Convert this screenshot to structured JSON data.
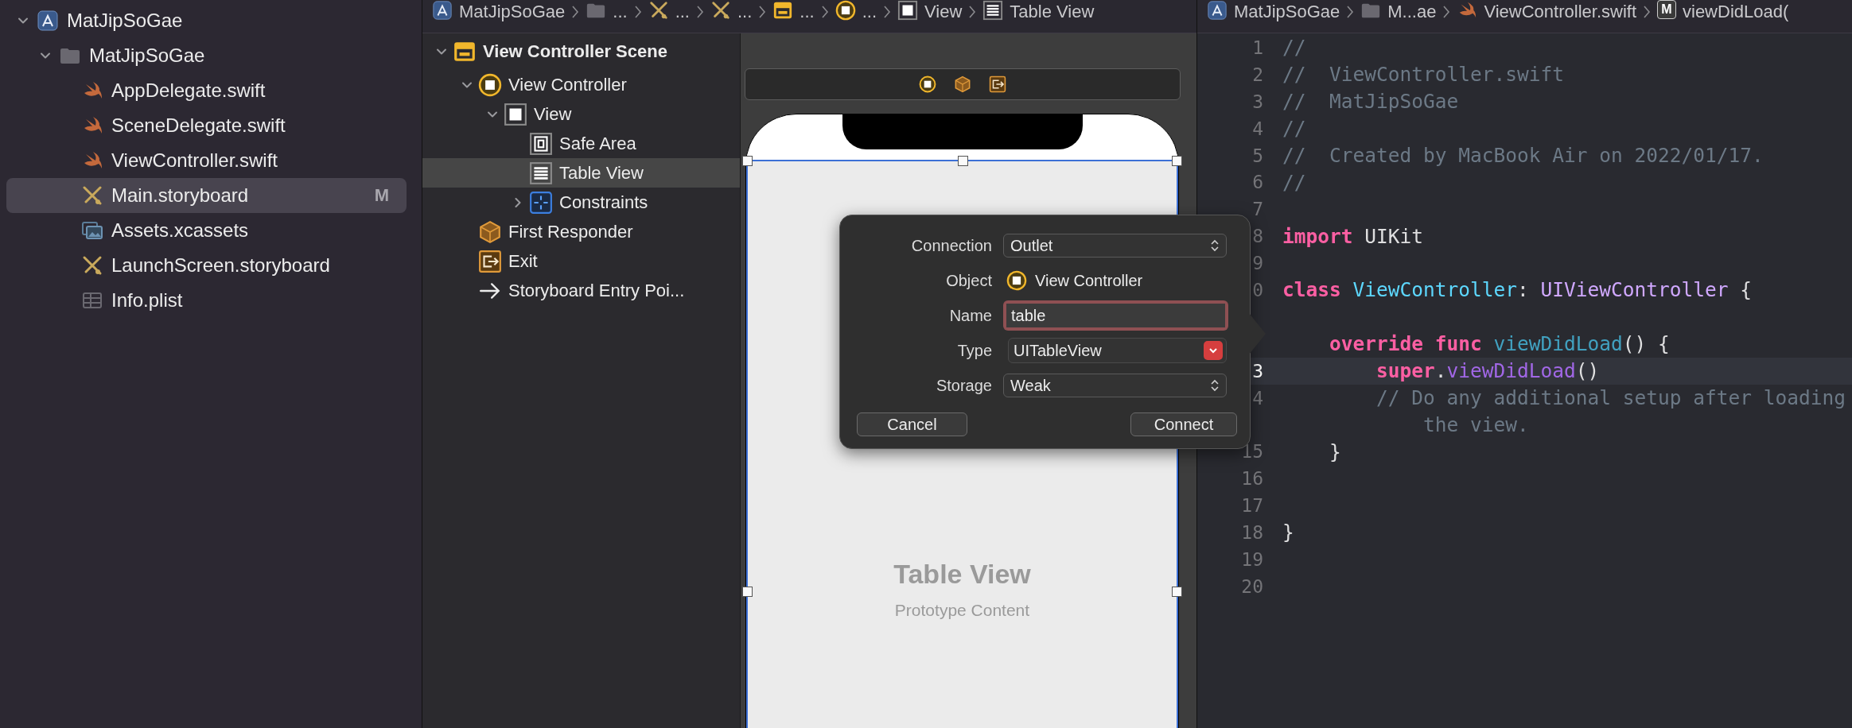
{
  "navigator": {
    "items": [
      {
        "label": "MatJipSoGae",
        "kind": "project",
        "expanded": true,
        "selected": false,
        "children": [
          {
            "label": "MatJipSoGae",
            "kind": "folder",
            "expanded": true,
            "selected": false,
            "children": [
              {
                "label": "AppDelegate.swift",
                "kind": "swift",
                "selected": false
              },
              {
                "label": "SceneDelegate.swift",
                "kind": "swift",
                "selected": false
              },
              {
                "label": "ViewController.swift",
                "kind": "swift",
                "selected": false
              },
              {
                "label": "Main.storyboard",
                "kind": "storyboard",
                "selected": true,
                "badge": "M"
              },
              {
                "label": "Assets.xcassets",
                "kind": "assets",
                "selected": false
              },
              {
                "label": "LaunchScreen.storyboard",
                "kind": "storyboard",
                "selected": false
              },
              {
                "label": "Info.plist",
                "kind": "plist",
                "selected": false
              }
            ]
          }
        ]
      }
    ]
  },
  "interface_builder": {
    "breadcrumbs": [
      {
        "label": "MatJipSoGae",
        "kind": "project"
      },
      {
        "label": "...",
        "kind": "folder"
      },
      {
        "label": "...",
        "kind": "storyboard"
      },
      {
        "label": "...",
        "kind": "storyboard"
      },
      {
        "label": "...",
        "kind": "scene"
      },
      {
        "label": "...",
        "kind": "view-controller"
      },
      {
        "label": "View",
        "kind": "view"
      },
      {
        "label": "Table View",
        "kind": "table-view"
      }
    ],
    "outline": [
      {
        "label": "View Controller Scene",
        "kind": "scene",
        "expanded": true,
        "selected": false,
        "children": [
          {
            "label": "View Controller",
            "kind": "view-controller",
            "expanded": true,
            "selected": false,
            "children": [
              {
                "label": "View",
                "kind": "view",
                "expanded": true,
                "selected": false,
                "children": [
                  {
                    "label": "Safe Area",
                    "kind": "safe-area",
                    "selected": false
                  },
                  {
                    "label": "Table View",
                    "kind": "table-view",
                    "selected": true
                  },
                  {
                    "label": "Constraints",
                    "kind": "constraints",
                    "expanded": false,
                    "selected": false
                  }
                ]
              }
            ]
          },
          {
            "label": "First Responder",
            "kind": "first-responder",
            "selected": false
          },
          {
            "label": "Exit",
            "kind": "exit",
            "selected": false
          },
          {
            "label": "Storyboard Entry Poi...",
            "kind": "entry-point",
            "selected": false
          }
        ]
      }
    ],
    "canvas": {
      "dock_icons": [
        {
          "kind": "view-controller"
        },
        {
          "kind": "first-responder"
        },
        {
          "kind": "exit"
        }
      ],
      "table_view": {
        "title": "Table View",
        "subtitle": "Prototype Content",
        "selected": true
      }
    },
    "connection_popover": {
      "connection": {
        "label": "Connection",
        "value": "Outlet"
      },
      "object": {
        "label": "Object",
        "value": "View Controller"
      },
      "name": {
        "label": "Name",
        "value": "table",
        "focused": true
      },
      "type": {
        "label": "Type",
        "value": "UITableView"
      },
      "storage": {
        "label": "Storage",
        "value": "Weak"
      },
      "buttons": [
        "Cancel",
        "Connect"
      ]
    }
  },
  "editor": {
    "breadcrumbs": [
      {
        "label": "MatJipSoGae",
        "kind": "project"
      },
      {
        "label": "M...ae",
        "kind": "folder"
      },
      {
        "label": "ViewController.swift",
        "kind": "swift"
      },
      {
        "label": "viewDidLoad(",
        "kind": "method",
        "badge": "M"
      }
    ],
    "lines": [
      {
        "number": "1",
        "tokens": [
          {
            "kind": "comment",
            "text": "//"
          }
        ]
      },
      {
        "number": "2",
        "tokens": [
          {
            "kind": "comment",
            "text": "//  ViewController.swift"
          }
        ]
      },
      {
        "number": "3",
        "tokens": [
          {
            "kind": "comment",
            "text": "//  MatJipSoGae"
          }
        ]
      },
      {
        "number": "4",
        "tokens": [
          {
            "kind": "comment",
            "text": "//"
          }
        ]
      },
      {
        "number": "5",
        "tokens": [
          {
            "kind": "comment",
            "text": "//  Created by MacBook Air on 2022/01/17."
          }
        ]
      },
      {
        "number": "6",
        "tokens": [
          {
            "kind": "comment",
            "text": "//"
          }
        ]
      },
      {
        "number": "7"
      },
      {
        "number": "8",
        "tokens": [
          {
            "kind": "keyword",
            "text": "import "
          },
          {
            "kind": "plain",
            "text": "UIKit"
          }
        ]
      },
      {
        "number": "9"
      },
      {
        "number": "0",
        "tokens": [
          {
            "kind": "keyword",
            "text": "class "
          },
          {
            "kind": "type-declaration",
            "text": "ViewController"
          },
          {
            "kind": "plain",
            "text": ": "
          },
          {
            "kind": "type",
            "text": "UIViewController"
          },
          {
            "kind": "plain",
            "text": " {"
          }
        ]
      },
      {
        "current": false
      },
      {
        "tokens": [
          {
            "kind": "keyword",
            "text": "    override func "
          },
          {
            "kind": "function-declaration",
            "text": "viewDidLoad"
          },
          {
            "kind": "plain",
            "text": "() {"
          }
        ]
      },
      {
        "number": "3",
        "current": true,
        "tokens": [
          {
            "kind": "keyword",
            "text": "        super"
          },
          {
            "kind": "plain",
            "text": "."
          },
          {
            "kind": "method",
            "text": "viewDidLoad"
          },
          {
            "kind": "plain",
            "text": "()"
          }
        ]
      },
      {
        "number": "4",
        "tokens": [
          {
            "kind": "comment",
            "text": "        // Do any additional setup after loading"
          }
        ]
      },
      {
        "tokens": [
          {
            "kind": "comment",
            "text": "            the view."
          }
        ]
      },
      {
        "number": "15",
        "tokens": [
          {
            "kind": "plain",
            "text": "    }"
          }
        ]
      },
      {
        "number": "16"
      },
      {
        "number": "17"
      },
      {
        "number": "18",
        "tokens": [
          {
            "kind": "plain",
            "text": "}"
          }
        ]
      },
      {
        "number": "19"
      },
      {
        "number": "20"
      }
    ]
  }
}
